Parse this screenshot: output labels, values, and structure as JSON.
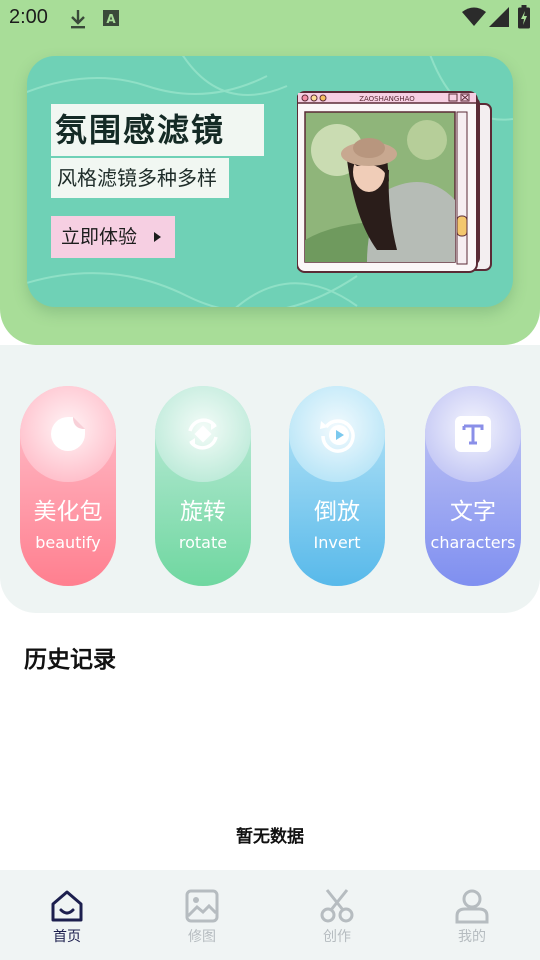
{
  "status_bar": {
    "time": "2:00"
  },
  "banner": {
    "title": "氛围感滤镜",
    "subtitle": "风格滤镜多种多样",
    "button_label": "立即体验",
    "frame_caption": "ZAOSHANGHAO"
  },
  "features": [
    {
      "zh": "美化包",
      "en": "beautify",
      "icon": "sticker-icon",
      "top": "#ffc4cf",
      "bottom": "#ff7f8f"
    },
    {
      "zh": "旋转",
      "en": "rotate",
      "icon": "rotate-icon",
      "top": "#c3ecdd",
      "bottom": "#6fd7a0"
    },
    {
      "zh": "倒放",
      "en": "Invert",
      "icon": "replay-icon",
      "top": "#bfe8f8",
      "bottom": "#58b9ea"
    },
    {
      "zh": "文字",
      "en": "characters",
      "icon": "text-icon",
      "top": "#c8cbf5",
      "bottom": "#7f8ff0"
    }
  ],
  "history": {
    "title": "历史记录",
    "empty_text": "暂无数据"
  },
  "tabbar": [
    {
      "label": "首页",
      "icon": "home-icon",
      "active": true
    },
    {
      "label": "修图",
      "icon": "image-icon",
      "active": false
    },
    {
      "label": "创作",
      "icon": "scissors-icon",
      "active": false
    },
    {
      "label": "我的",
      "icon": "user-icon",
      "active": false
    }
  ]
}
